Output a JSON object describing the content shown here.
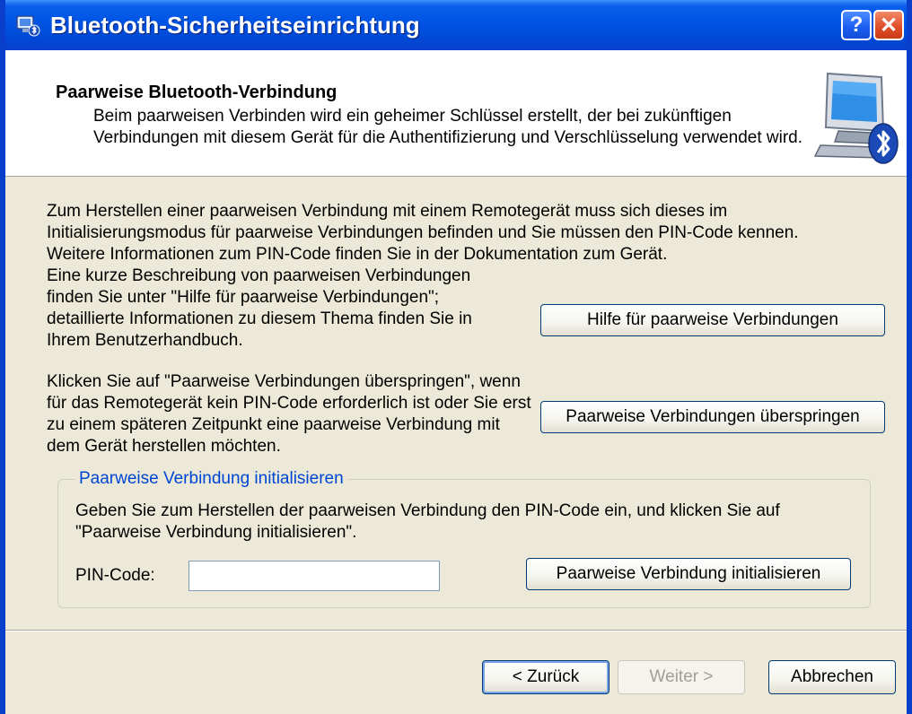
{
  "window": {
    "title": "Bluetooth-Sicherheitseinrichtung",
    "help_label": "?",
    "close_label": "✕"
  },
  "header": {
    "title": "Paarweise Bluetooth-Verbindung",
    "description": "Beim paarweisen Verbinden wird ein geheimer Schlüssel erstellt, der bei zukünftigen Verbindungen mit diesem Gerät für die Authentifizierung und Verschlüsselung verwendet wird."
  },
  "body": {
    "intro": "Zum Herstellen einer paarweisen Verbindung mit einem Remotegerät muss sich dieses im Initialisierungsmodus für paarweise Verbindungen befinden und Sie müssen den PIN-Code kennen. Weitere Informationen zum PIN-Code finden Sie in der Dokumentation zum Gerät.",
    "help_text": "Eine kurze Beschreibung von paarweisen Verbindungen finden Sie unter \"Hilfe für paarweise Verbindungen\"; detaillierte Informationen zu diesem Thema finden Sie in Ihrem Benutzerhandbuch.",
    "help_button": "Hilfe für paarweise Verbindungen",
    "skip_text": "Klicken Sie auf \"Paarweise Verbindungen überspringen\", wenn für das Remotegerät kein PIN-Code erforderlich ist oder Sie erst zu einem späteren Zeitpunkt eine paarweise Verbindung mit dem Gerät herstellen möchten.",
    "skip_button": "Paarweise Verbindungen überspringen"
  },
  "group": {
    "legend": "Paarweise Verbindung initialisieren",
    "instruction": "Geben Sie zum Herstellen der paarweisen Verbindung den PIN-Code ein, und klicken Sie auf \"Paarweise Verbindung initialisieren\".",
    "pin_label": "PIN-Code:",
    "pin_value": "",
    "init_button": "Paarweise Verbindung initialisieren"
  },
  "footer": {
    "back": "< Zurück",
    "next": "Weiter >",
    "cancel": "Abbrechen"
  },
  "colors": {
    "titlebar": "#0055e5",
    "dialog_bg": "#ece9d8",
    "group_legend": "#0046d5"
  }
}
